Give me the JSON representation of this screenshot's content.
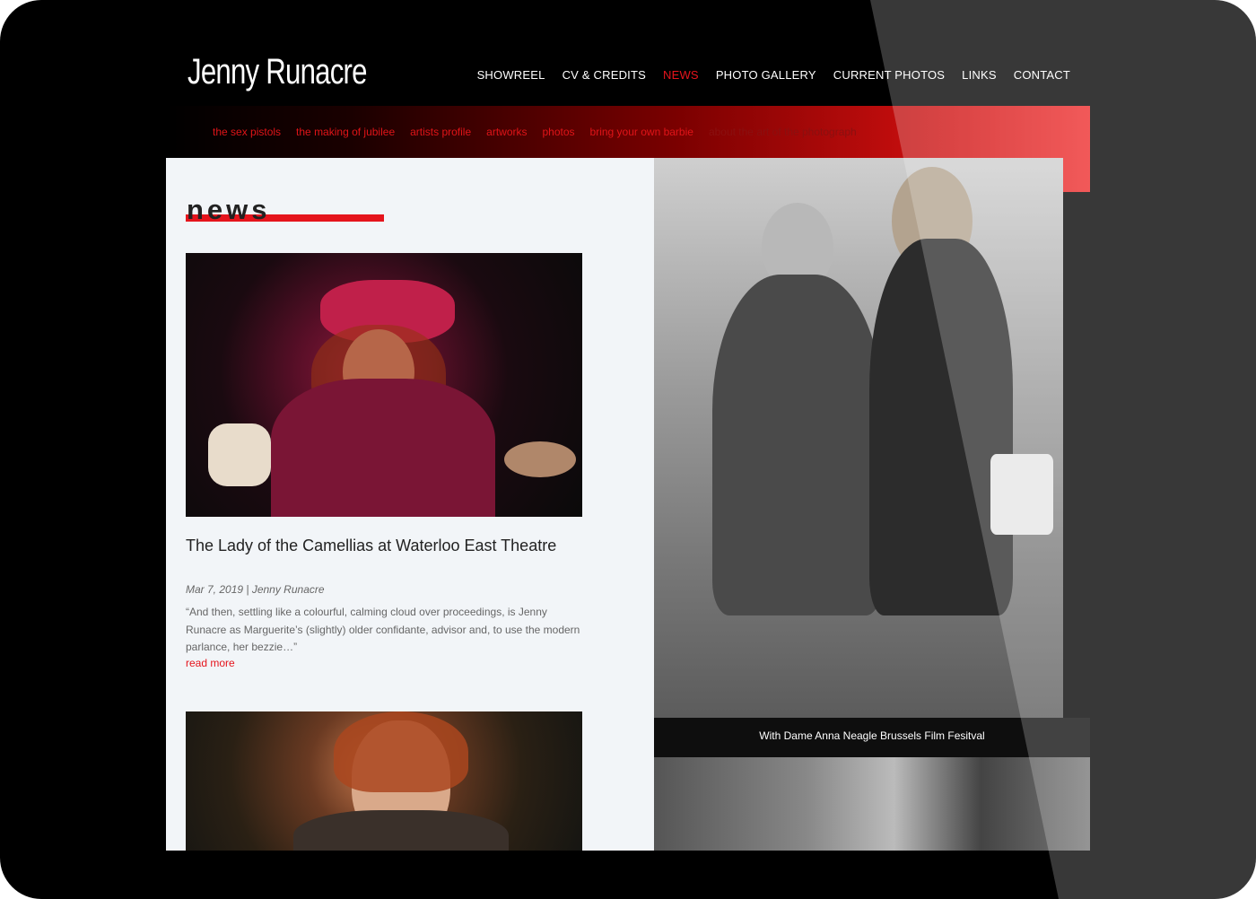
{
  "site": {
    "logo": "Jenny Runacre"
  },
  "main_nav": [
    {
      "label": "SHOWREEL",
      "active": false
    },
    {
      "label": "CV & CREDITS",
      "active": false
    },
    {
      "label": "NEWS",
      "active": true
    },
    {
      "label": "PHOTO GALLERY",
      "active": false
    },
    {
      "label": "CURRENT PHOTOS",
      "active": false
    },
    {
      "label": "LINKS",
      "active": false
    },
    {
      "label": "CONTACT",
      "active": false
    }
  ],
  "sub_nav": [
    {
      "label": "the sex pistols"
    },
    {
      "label": "the making of jubilee"
    },
    {
      "label": "artists profile"
    },
    {
      "label": "artworks"
    },
    {
      "label": "photos"
    },
    {
      "label": "bring your own barbie"
    },
    {
      "label": "about the art of the photograph"
    }
  ],
  "news": {
    "heading": "news",
    "post": {
      "title": "The Lady of the Camellias at Waterloo East Theatre",
      "meta": "Mar 7, 2019 | Jenny Runacre",
      "excerpt": "“And then, settling like a colourful, calming cloud over proceedings, is Jenny Runacre as Marguerite’s (slightly) older confidante, advisor and, to use the modern parlance, her bezzie…”",
      "read_more": "read more"
    }
  },
  "gallery": {
    "caption": "With Dame Anna Neagle Brussels Film Fesitval"
  },
  "colors": {
    "accent": "#e5141c",
    "background": "#000000",
    "panel": "#f2f5f8"
  }
}
